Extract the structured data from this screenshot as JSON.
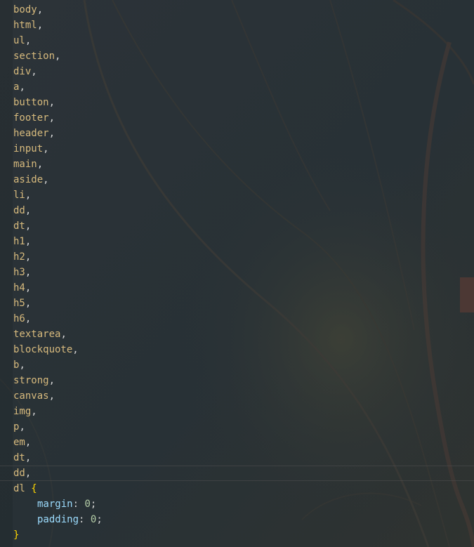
{
  "editor": {
    "selectors": [
      "body",
      "html",
      "ul",
      "section",
      "div",
      "a",
      "button",
      "footer",
      "header",
      "input",
      "main",
      "aside",
      "li",
      "dd",
      "dt",
      "h1",
      "h2",
      "h3",
      "h4",
      "h5",
      "h6",
      "textarea",
      "blockquote",
      "b",
      "strong",
      "canvas",
      "img",
      "p",
      "em",
      "dt",
      "dd",
      "dl"
    ],
    "comma": ",",
    "open_brace": "{",
    "close_brace": "}",
    "declarations": [
      {
        "property": "margin",
        "value": "0"
      },
      {
        "property": "padding",
        "value": "0"
      }
    ],
    "colon": ":",
    "semicolon": ";"
  },
  "colors": {
    "selector": "#d7ba7d",
    "property": "#9cdcfe",
    "number": "#b5cea8",
    "brace": "#ffd700",
    "background": "#2a3136"
  }
}
